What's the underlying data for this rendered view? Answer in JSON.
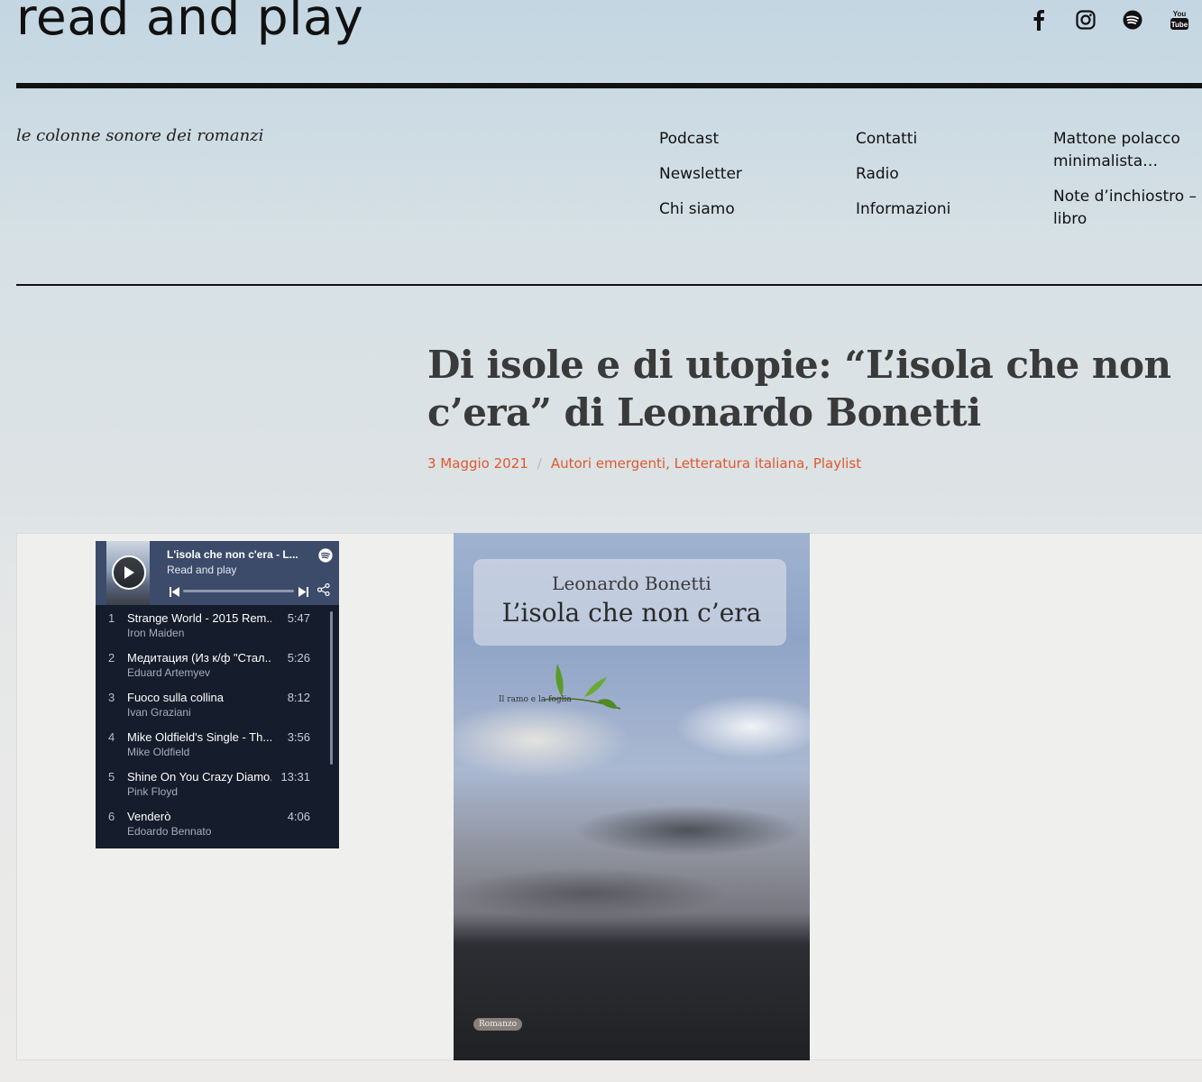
{
  "site": {
    "title": "read and play",
    "tagline": "le colonne sonore dei romanzi"
  },
  "social": [
    {
      "name": "facebook-icon"
    },
    {
      "name": "instagram-icon"
    },
    {
      "name": "spotify-icon"
    },
    {
      "name": "youtube-icon",
      "label": "You Tube"
    }
  ],
  "nav": {
    "col1": [
      "Podcast",
      "Newsletter",
      "Chi siamo"
    ],
    "col2": [
      "Contatti",
      "Radio",
      "Informazioni"
    ],
    "col3": [
      "Mattone polacco minimalista…",
      "Note d’inchiostro – libro"
    ]
  },
  "post": {
    "title": "Di isole e di utopie: “L’isola che non c’era” di Leonardo Bonetti",
    "date": "3 Maggio 2021",
    "separator": "/",
    "categories": [
      "Autori emergenti",
      "Letteratura italiana",
      "Playlist"
    ]
  },
  "player": {
    "title": "L'isola che non c'era - L...",
    "author": "Read and play",
    "tracks": [
      {
        "num": "1",
        "name": "Strange World - 2015 Rem...",
        "artist": "Iron Maiden",
        "duration": "5:47"
      },
      {
        "num": "2",
        "name": "Медитация (Из к/ф \"Стал...",
        "artist": "Eduard Artemyev",
        "duration": "5:26"
      },
      {
        "num": "3",
        "name": "Fuoco sulla collina",
        "artist": "Ivan Graziani",
        "duration": "8:12"
      },
      {
        "num": "4",
        "name": "Mike Oldfield's Single - Th...",
        "artist": "Mike Oldfield",
        "duration": "3:56"
      },
      {
        "num": "5",
        "name": "Shine On You Crazy Diamo...",
        "artist": "Pink Floyd",
        "duration": "13:31"
      },
      {
        "num": "6",
        "name": "Venderò",
        "artist": "Edoardo Bennato",
        "duration": "4:06"
      }
    ]
  },
  "cover": {
    "author": "Leonardo Bonetti",
    "title": "L’isola che non c’era",
    "publisher": "Il ramo e la foglia",
    "badge": "Romanzo"
  },
  "colors": {
    "accent": "#e0572f",
    "player_bg": "#151c2b",
    "player_header": "#3c4b6a"
  }
}
